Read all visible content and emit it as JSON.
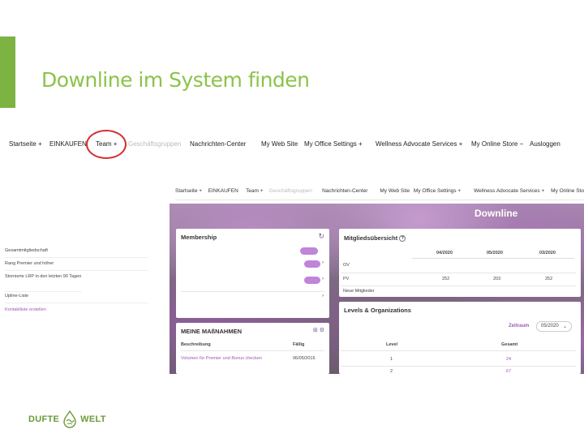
{
  "slide": {
    "title": "Downline im System finden"
  },
  "nav_top": {
    "items": [
      "Startseite +",
      "EINKAUFEN",
      "Team +",
      "Geschäftsgruppen",
      "Nachrichten-Center",
      "My Web Site",
      "My Office Settings +",
      "Wellness Advocate Services +",
      "My Online Store −",
      "Ausloggen"
    ]
  },
  "nav_screenshot": {
    "items": [
      "Startseite +",
      "EINKAUFEN",
      "Team +",
      "Geschäftsgruppen",
      "Nachrichten-Center",
      "My Web Site",
      "My Office Settings +",
      "Wellness Advocate Services +",
      "My Online Sto"
    ]
  },
  "hero": {
    "title": "Downline"
  },
  "membership": {
    "title": "Membership",
    "rows": [
      {
        "label": "Gesamtmitgliedschaft"
      },
      {
        "label": "Rang Premier und höher"
      },
      {
        "label": "Stornierte LRP in den letzten 90 Tagen"
      },
      {
        "label": "Upline-Liste"
      }
    ],
    "link": "Kontaktliste erstellen"
  },
  "massnahmen": {
    "title": "MEINE MAßNAHMEN",
    "col_desc": "Beschreibung",
    "col_due": "Fällig",
    "row_desc": "Volumen für Premier und Bonus checken",
    "row_due": "06/05/2016"
  },
  "mitglied": {
    "title": "Mitgliedsübersicht",
    "help": "?",
    "col1": "04/2020",
    "col2": "05/2020",
    "col3": "03/2020",
    "row_ov": "OV",
    "row_pv": "PV",
    "pv1": "252",
    "pv2": "203",
    "pv3": "252",
    "row_new": "Neue Mitglieder"
  },
  "levels": {
    "title": "Levels & Organizations",
    "zeitraum_label": "Zeitraum",
    "zeitraum_value": "05/2020",
    "col_level": "Level",
    "col_gesamt": "Gesamt",
    "row1_level": "1",
    "row1_gesamt": "24",
    "row2_level": "2",
    "row2_gesamt": "67"
  },
  "logo": {
    "left": "DUFTE",
    "right": "WELT"
  },
  "colors": {
    "accent": "#7cb342",
    "title": "#8bc34a",
    "highlight_circle": "#d32f2f",
    "toggle": "#c084d8",
    "link": "#9b59b6"
  }
}
